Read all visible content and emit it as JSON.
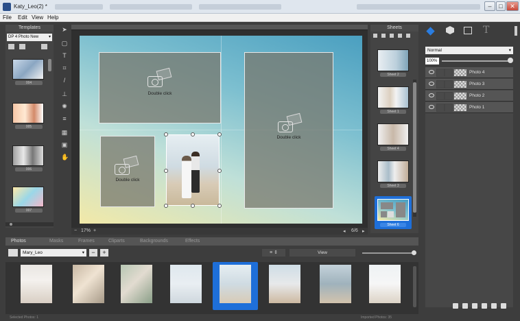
{
  "window": {
    "title": "Katy_Leo(2) *",
    "controls": [
      "–",
      "□",
      "✕"
    ]
  },
  "menu": [
    "File",
    "Edit",
    "View",
    "Help"
  ],
  "templates": {
    "header": "Templates",
    "dropdown_value": "DP 4 Photo New",
    "items": [
      "004",
      "005",
      "006",
      "007"
    ]
  },
  "canvas": {
    "placeholder_text": "Double click",
    "zoom": "17%",
    "page_indicator": "6/6"
  },
  "sheets": {
    "header": "Sheets",
    "items": [
      "Sheet 2",
      "Sheet 1",
      "Sheet 4",
      "Sheet 3",
      "Sheet 6"
    ],
    "selected": "Sheet 6"
  },
  "layers": {
    "blend_mode": "Normal",
    "opacity": "100%",
    "items": [
      "Photo 4",
      "Photo 3",
      "Photo 2",
      "Photo 1"
    ]
  },
  "bottom_tabs": [
    "Photos",
    "Masks",
    "Frames",
    "Cliparts",
    "Backgrounds",
    "Effects"
  ],
  "photos": {
    "album": "Mary_Leo",
    "view_label": "View",
    "selected_index": 4,
    "count": 8
  },
  "status": {
    "left": "Selected Photos: 1",
    "right": "Imported Photos: 35"
  },
  "colors": {
    "selection": "#1e6fd9",
    "panel": "#3d3d3d",
    "canvas_gradient_start": "#f2e9a8",
    "canvas_gradient_end": "#4aa0c0"
  }
}
